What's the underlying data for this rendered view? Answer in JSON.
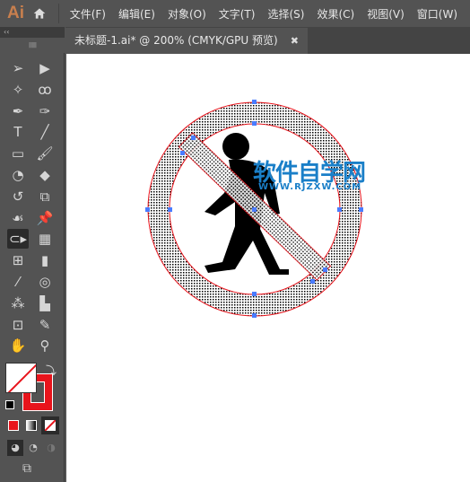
{
  "app": {
    "logo": "Ai",
    "home_icon": "home-icon"
  },
  "menu": [
    "文件(F)",
    "编辑(E)",
    "对象(O)",
    "文字(T)",
    "选择(S)",
    "效果(C)",
    "视图(V)",
    "窗口(W)"
  ],
  "panel": {
    "collapse": "‹‹",
    "grip": "||||||||"
  },
  "tab": {
    "title": "未标题-1.ai* @ 200% (CMYK/GPU 预览)",
    "close": "✖"
  },
  "tools": [
    {
      "name": "selection-tool",
      "glyph": "➢"
    },
    {
      "name": "direct-selection-tool",
      "glyph": "▶"
    },
    {
      "name": "magic-wand-tool",
      "glyph": "✧"
    },
    {
      "name": "lasso-tool",
      "glyph": "ꝏ"
    },
    {
      "name": "pen-tool",
      "glyph": "✒"
    },
    {
      "name": "curvature-tool",
      "glyph": "✑"
    },
    {
      "name": "type-tool",
      "glyph": "T"
    },
    {
      "name": "line-tool",
      "glyph": "╱"
    },
    {
      "name": "rectangle-tool",
      "glyph": "▭"
    },
    {
      "name": "paintbrush-tool",
      "glyph": "🖌"
    },
    {
      "name": "shaper-tool",
      "glyph": "◔"
    },
    {
      "name": "eraser-tool",
      "glyph": "◆"
    },
    {
      "name": "rotate-tool",
      "glyph": "↺"
    },
    {
      "name": "scale-tool",
      "glyph": "⧉"
    },
    {
      "name": "warp-tool",
      "glyph": "☙"
    },
    {
      "name": "puppet-warp-tool",
      "glyph": "📌"
    },
    {
      "name": "shape-builder-tool",
      "glyph": "⊂▸"
    },
    {
      "name": "perspective-grid-tool",
      "glyph": "▦"
    },
    {
      "name": "mesh-tool",
      "glyph": "⊞"
    },
    {
      "name": "gradient-tool",
      "glyph": "▮"
    },
    {
      "name": "eyedropper-tool",
      "glyph": "⁄"
    },
    {
      "name": "blend-tool",
      "glyph": "◎"
    },
    {
      "name": "symbol-sprayer-tool",
      "glyph": "⁂"
    },
    {
      "name": "column-graph-tool",
      "glyph": "▙"
    },
    {
      "name": "artboard-tool",
      "glyph": "⊡"
    },
    {
      "name": "slice-tool",
      "glyph": "✎"
    },
    {
      "name": "hand-tool",
      "glyph": "✋"
    },
    {
      "name": "zoom-tool",
      "glyph": "⚲"
    }
  ],
  "colors": {
    "fill": "#ffffff",
    "stroke": "#e8141c",
    "accent_red": "#e8141c"
  },
  "canvas": {
    "watermark_cn": "软件自学网",
    "watermark_url": "WWW.RJZXW.COM"
  }
}
